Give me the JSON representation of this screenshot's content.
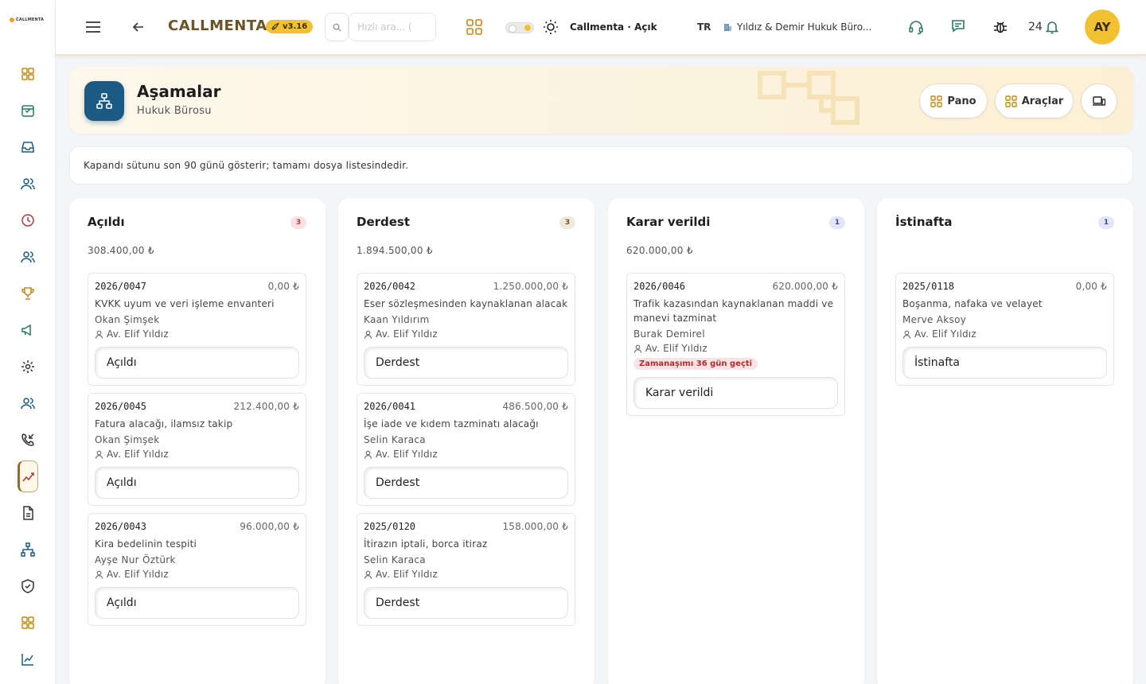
{
  "logo": {
    "text": "CALLMENTA"
  },
  "topbar": {
    "brand": "CALLMENTA",
    "version": "v3.16",
    "search_placeholder": "Hızlı ara... (",
    "theme_label": "Callmenta · Açık",
    "language": "TR",
    "office": "Yıldız & Demir Hukuk Büro...",
    "notifications": "24",
    "avatar_initials": "AY"
  },
  "sidebar": {
    "icons": [
      "dashboard-icon",
      "calendar-check-icon",
      "inbox-icon",
      "users-icon",
      "clock-icon",
      "team-icon",
      "trophy-icon",
      "megaphone-icon",
      "settings-gear-icon",
      "contacts-icon",
      "phone-incoming-icon",
      "workflow-chart-icon",
      "document-icon",
      "hierarchy-icon",
      "shield-check-icon",
      "grid-icon",
      "analytics-icon"
    ]
  },
  "page": {
    "title": "Aşamalar",
    "subtitle": "Hukuk Bürosu",
    "buttons": {
      "pano": "Pano",
      "araclar": "Araçlar"
    }
  },
  "info_text": "Kapandı sütunu son 90 günü gösterir; tamamı dosya listesindedir.",
  "columns": [
    {
      "title": "Açıldı",
      "count": "3",
      "total": "308.400,00 ₺",
      "count_bg": "#fbe1e1",
      "count_color": "#b33a3a",
      "cards": [
        {
          "no": "2026/0047",
          "amount": "0,00 ₺",
          "desc": "KVKK uyum ve veri işleme envanteri",
          "client": "Okan Şimşek",
          "lawyer": "Av. Elif Yıldız",
          "stage": "Açıldı"
        },
        {
          "no": "2026/0045",
          "amount": "212.400,00 ₺",
          "desc": "Fatura alacağı, ilamsız takip",
          "client": "Okan Şimşek",
          "lawyer": "Av. Elif Yıldız",
          "stage": "Açıldı"
        },
        {
          "no": "2026/0043",
          "amount": "96.000,00 ₺",
          "desc": "Kira bedelinin tespiti",
          "client": "Ayşe Nur Öztürk",
          "lawyer": "Av. Elif Yıldız",
          "stage": "Açıldı"
        }
      ]
    },
    {
      "title": "Derdest",
      "count": "3",
      "total": "1.894.500,00 ₺",
      "count_bg": "#efeadb",
      "count_color": "#6b5528",
      "cards": [
        {
          "no": "2026/0042",
          "amount": "1.250.000,00 ₺",
          "desc": "Eser sözleşmesinden kaynaklanan alacak",
          "client": "Kaan Yıldırım",
          "lawyer": "Av. Elif Yıldız",
          "stage": "Derdest"
        },
        {
          "no": "2026/0041",
          "amount": "486.500,00 ₺",
          "desc": "İşe iade ve kıdem tazminatı alacağı",
          "client": "Selin Karaca",
          "lawyer": "Av. Elif Yıldız",
          "stage": "Derdest"
        },
        {
          "no": "2025/0120",
          "amount": "158.000,00 ₺",
          "desc": "İtirazın iptali, borca itiraz",
          "client": "Selin Karaca",
          "lawyer": "Av. Elif Yıldız",
          "stage": "Derdest"
        }
      ]
    },
    {
      "title": "Karar verildi",
      "count": "1",
      "total": "620.000,00 ₺",
      "count_bg": "#e3e6fa",
      "count_color": "#3b47a6",
      "cards": [
        {
          "no": "2026/0046",
          "amount": "620.000,00 ₺",
          "desc": "Trafik kazasından kaynaklanan maddi ve manevi tazminat",
          "client": "Burak Demirel",
          "lawyer": "Av. Elif Yıldız",
          "warning": "Zamanaşımı 36 gün geçti",
          "stage": "Karar verildi"
        }
      ]
    },
    {
      "title": "İstinafta",
      "count": "1",
      "total": "",
      "count_bg": "#e3e6fa",
      "count_color": "#3b47a6",
      "cards": [
        {
          "no": "2025/0118",
          "amount": "0,00 ₺",
          "desc": "Boşanma, nafaka ve velayet",
          "client": "Merve Aksoy",
          "lawyer": "Av. Elif Yıldız",
          "stage": "İstinafta"
        }
      ]
    }
  ],
  "colors": {
    "accent": "#f0c232",
    "brand": "#6b5528",
    "primary": "#1b5b83",
    "header_bg": "#fcf0d4"
  }
}
